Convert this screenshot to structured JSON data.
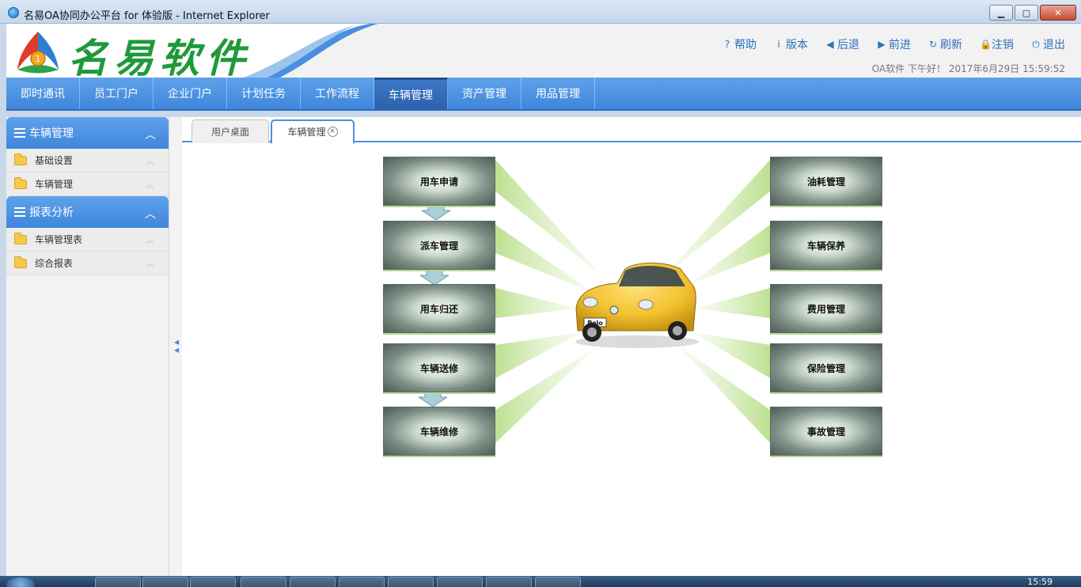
{
  "window": {
    "title": "名易OA协同办公平台 for 体验版 - Internet Explorer",
    "buttons": [
      "minimize",
      "maximize",
      "close"
    ]
  },
  "header": {
    "logo_text": "名易软件",
    "links": [
      {
        "icon": "help-icon",
        "glyph": "?",
        "label": "帮助"
      },
      {
        "icon": "info-icon",
        "glyph": "i",
        "label": "版本"
      },
      {
        "icon": "back-icon",
        "glyph": "◀",
        "label": "后退"
      },
      {
        "icon": "forward-icon",
        "glyph": "▶",
        "label": "前进"
      },
      {
        "icon": "refresh-icon",
        "glyph": "↻",
        "label": "刷新"
      },
      {
        "icon": "lock-icon",
        "glyph": "🔒",
        "label": "注销"
      },
      {
        "icon": "power-icon",
        "glyph": "⏻",
        "label": "退出"
      }
    ],
    "greeting": "OA软件 下午好！ 2017年6月29日 15:59:52"
  },
  "nav": {
    "items": [
      "即时通讯",
      "员工门户",
      "企业门户",
      "计划任务",
      "工作流程",
      "车辆管理",
      "资产管理",
      "用品管理"
    ],
    "active": "车辆管理"
  },
  "sidebar": {
    "groups": [
      {
        "title": "车辆管理",
        "items": [
          "基础设置",
          "车辆管理"
        ]
      },
      {
        "title": "报表分析",
        "items": [
          "车辆管理表",
          "综合报表"
        ]
      }
    ]
  },
  "tabs": {
    "items": [
      "用户桌面",
      "车辆管理"
    ],
    "active": "车辆管理"
  },
  "diagram": {
    "left": [
      "用车申请",
      "派车管理",
      "用车归还",
      "车辆送修",
      "车辆维修"
    ],
    "right": [
      "油耗管理",
      "车辆保养",
      "费用管理",
      "保险管理",
      "事故管理"
    ],
    "car_badge": "Polo",
    "colors": {
      "car": "#f2c12e",
      "beam": "#c8e6a0",
      "arrow": "#a9cfd8"
    }
  },
  "taskbar": {
    "clock": "15:59"
  }
}
